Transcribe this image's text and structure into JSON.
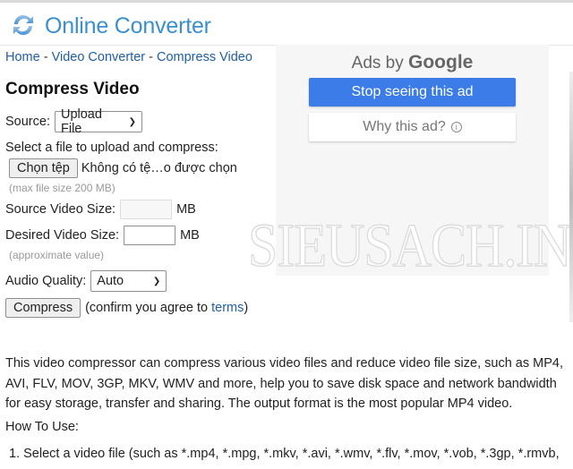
{
  "header": {
    "logo_icon": "refresh-arrows-icon",
    "site_title": "Online Converter"
  },
  "breadcrumb": {
    "items": [
      "Home",
      "Video Converter",
      "Compress Video"
    ],
    "separator": " - "
  },
  "page_title": "Compress Video",
  "form": {
    "source_label": "Source:",
    "source_value": "Upload File",
    "file_prompt": "Select a file to upload and compress:",
    "choose_file_button": "Chọn tệp",
    "no_file_text": "Không có tệ…o được chọn",
    "max_size_hint": "(max file size 200 MB)",
    "source_size_label": "Source Video Size:",
    "source_size_value": "",
    "source_size_unit": "MB",
    "desired_size_label": "Desired Video Size:",
    "desired_size_value": "",
    "desired_size_unit": "MB",
    "approx_hint": "(approximate value)",
    "audio_label": "Audio Quality:",
    "audio_value": "Auto",
    "compress_button": "Compress",
    "confirm_prefix": "(confirm you agree to ",
    "terms_link": "terms",
    "confirm_suffix": ")"
  },
  "ad": {
    "back_icon": "arrow-left-icon",
    "ads_by": "Ads by",
    "google": "Google",
    "stop_button": "Stop seeing this ad",
    "why_button": "Why this ad?",
    "info_icon": "info-icon"
  },
  "watermark": "SIEUSACH.INFO",
  "content": {
    "description": "This video compressor can compress various video files and reduce video file size, such as MP4, AVI, FLV, MOV, 3GP, MKV, WMV and more, help you to save disk space and network bandwidth for easy storage, transfer and sharing. The output format is the most popular MP4 video.",
    "how_to_heading": "How To Use:",
    "steps": [
      "1. Select a video file (such as *.mp4, *.mpg, *.mkv, *.avi, *.wmv, *.flv, *.mov, *.vob, *.3gp, *.rmvb,"
    ]
  },
  "colors": {
    "brand_blue": "#3a8fd0",
    "link_blue": "#1f5ea8",
    "ad_button_blue": "#3b7ce8"
  }
}
